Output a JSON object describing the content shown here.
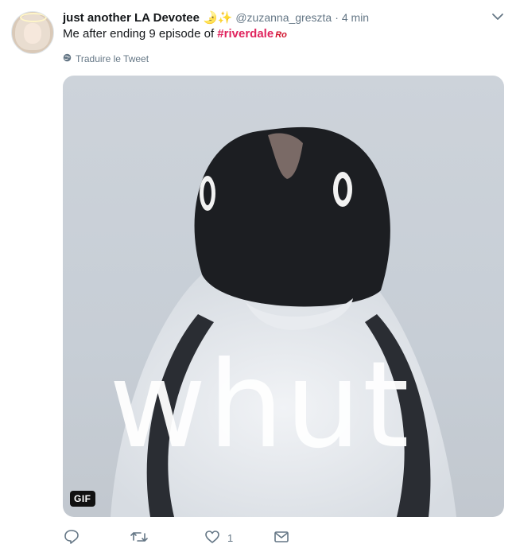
{
  "tweet": {
    "author_name": "just another LA Devotee",
    "author_emoji": "🌛✨",
    "handle": "@zuzanna_greszta",
    "separator": "·",
    "time": "4 min",
    "text_prefix": "Me after ending 9 episode of ",
    "hashtag": "#riverdale",
    "hashtag_emoji": "Ro",
    "translate_label": "Traduire le Tweet",
    "media": {
      "overlay_text": "whut",
      "gif_badge": "GIF"
    },
    "actions": {
      "reply_count": "",
      "retweet_count": "",
      "like_count": "1",
      "dm_count": ""
    }
  },
  "icons": {
    "menu": "chevron-down-icon",
    "globe": "globe-icon",
    "reply": "reply-icon",
    "retweet": "retweet-icon",
    "like": "heart-icon",
    "dm": "envelope-icon"
  },
  "colors": {
    "hashtag": "#e0245e",
    "secondary_text": "#657786",
    "gif_badge_bg": "#111111"
  }
}
